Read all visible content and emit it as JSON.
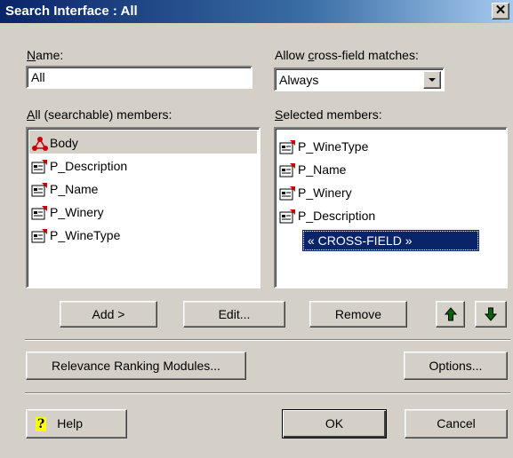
{
  "window": {
    "title": "Search Interface : All",
    "close_label": "✕"
  },
  "name_field": {
    "label": "Name:",
    "value": "All"
  },
  "cross_field": {
    "label": "Allow cross-field matches:",
    "selected": "Always"
  },
  "all_members": {
    "label": "All (searchable) members:",
    "items": [
      {
        "label": "Body",
        "icon": "body-node-icon"
      },
      {
        "label": "P_Description",
        "icon": "property-icon"
      },
      {
        "label": "P_Name",
        "icon": "property-icon"
      },
      {
        "label": "P_Winery",
        "icon": "property-icon"
      },
      {
        "label": "P_WineType",
        "icon": "property-icon"
      }
    ]
  },
  "selected_members": {
    "label": "Selected members:",
    "items": [
      {
        "label": "P_WineType",
        "icon": "property-icon"
      },
      {
        "label": "P_Name",
        "icon": "property-icon"
      },
      {
        "label": "P_Winery",
        "icon": "property-icon"
      },
      {
        "label": "P_Description",
        "icon": "property-icon"
      },
      {
        "label": "« CROSS-FIELD »",
        "selected": true
      }
    ]
  },
  "buttons": {
    "add": "Add >",
    "edit": "Edit...",
    "remove": "Remove",
    "up_icon": "arrow-up-icon",
    "down_icon": "arrow-down-icon",
    "relevance": "Relevance Ranking Modules...",
    "options": "Options...",
    "help": "Help",
    "ok": "OK",
    "cancel": "Cancel"
  },
  "colors": {
    "titlebar": "#0a246a",
    "selection": "#0a246a",
    "face": "#d4d0c8",
    "body_icon": "#cc0000",
    "arrow_icon": "#006400"
  }
}
